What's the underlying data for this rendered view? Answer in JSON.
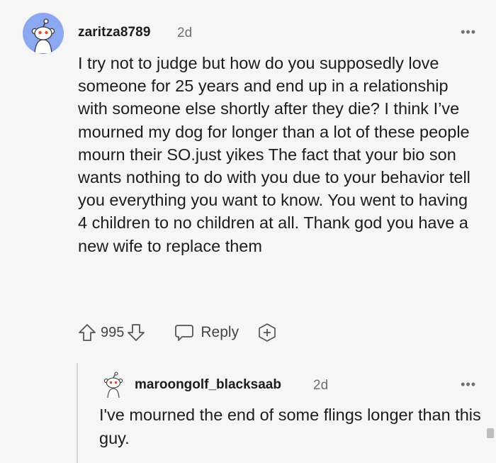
{
  "comment": {
    "username": "zaritza8789",
    "time": "2d",
    "more_label": "•••",
    "body": "I try not to judge but how do you supposedly love someone for 25 years and end up in a relationship with someone else shortly after they die? I think I’ve mourned my dog for longer than a lot of these people mourn their SO.just yikes The fact that your bio son wants nothing to do with you due to your behavior tell you everything you want to know. You went to having 4 children to no children at all. Thank god you have a new wife to replace them",
    "vote_count": "995",
    "reply_label": "Reply",
    "avatar_color": "#8da8f2"
  },
  "reply": {
    "username": "maroongolf_blacksaab",
    "time": "2d",
    "more_label": "•••",
    "body": "I've mourned the end of some flings longer than this guy."
  },
  "icons": {
    "upvote": "arrow-up-icon",
    "downvote": "arrow-down-icon",
    "reply": "speech-bubble-icon",
    "award": "plus-award-icon",
    "more": "ellipsis-icon"
  }
}
